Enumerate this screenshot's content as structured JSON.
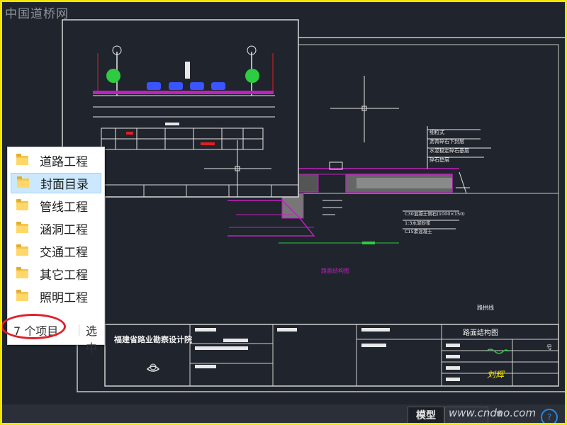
{
  "watermark_top": "中国道桥网",
  "watermark_bottom": "www.cndao.com",
  "statusbar": {
    "model_tab": "模型",
    "help": "?"
  },
  "explorer": {
    "items": [
      {
        "label": "道路工程",
        "selected": false
      },
      {
        "label": "封面目录",
        "selected": true
      },
      {
        "label": "管线工程",
        "selected": false
      },
      {
        "label": "涵洞工程",
        "selected": false
      },
      {
        "label": "交通工程",
        "selected": false
      },
      {
        "label": "其它工程",
        "selected": false
      },
      {
        "label": "照明工程",
        "selected": false
      }
    ],
    "count": "7 个项目",
    "selected": "选中"
  },
  "drawing": {
    "institute": "福建省路业勘察设计院",
    "sheet_title": "路面结构图",
    "detail_title": "路面结构图",
    "note": "路拱线",
    "layers": [
      "细粒式",
      "沥青碎石下封层",
      "水泥稳定碎石基层",
      "碎石垫层"
    ],
    "curb_labels": [
      "C30混凝土侧石(1000×150)",
      "1:3水泥砂浆",
      "C15素混凝土"
    ],
    "signature": "刘辉"
  }
}
